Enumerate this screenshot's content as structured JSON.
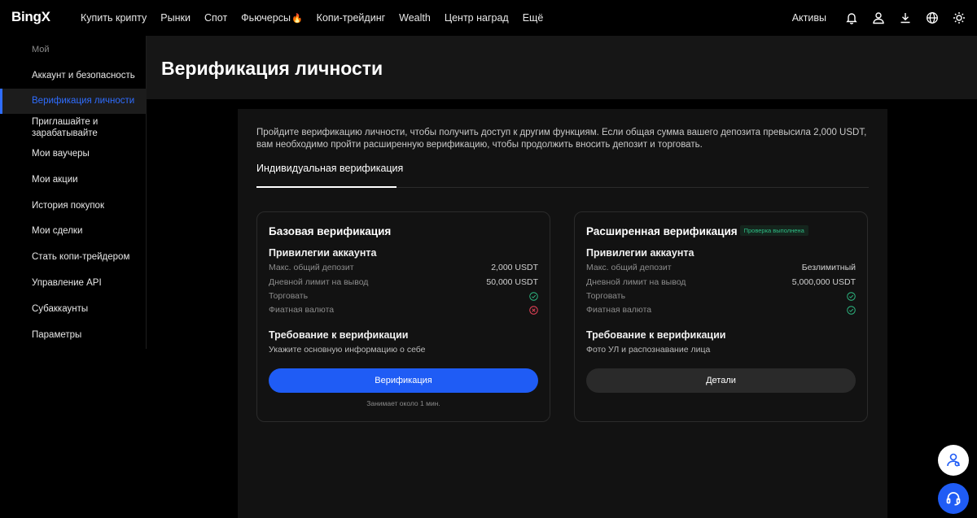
{
  "brand": {
    "logo": "BingX"
  },
  "nav": {
    "items": [
      "Купить крипту",
      "Рынки",
      "Спот",
      "Фьючерсы",
      "Копи-трейдинг",
      "Wealth",
      "Центр наград",
      "Ещё"
    ],
    "assets": "Активы"
  },
  "sidebar": {
    "header": "Мой",
    "items": [
      "Аккаунт и безопасность",
      "Верификация личности",
      "Приглашайте и",
      "зарабатывайте",
      "Мои ваучеры",
      "Мои акции",
      "История покупок",
      "Мои сделки",
      "Стать копи-трейдером",
      "Управление API",
      "Субаккаунты",
      "Параметры"
    ],
    "active_index": 1
  },
  "page": {
    "title": "Верификация личности",
    "intro": "Пройдите верификацию личности, чтобы получить доступ к другим функциям. Если общая сумма вашего депозита превысила 2,000 USDT, вам необходимо пройти расширенную верификацию, чтобы продолжить вносить депозит и торговать.",
    "tab": "Индивидуальная верификация"
  },
  "cards": {
    "basic": {
      "title": "Базовая верификация",
      "privileges_title": "Привилегии аккаунта",
      "rows": [
        {
          "label": "Макс. общий депозит",
          "value": "2,000 USDT"
        },
        {
          "label": "Дневной лимит на вывод",
          "value": "50,000 USDT"
        },
        {
          "label": "Торговать",
          "status": "ok"
        },
        {
          "label": "Фиатная валюта",
          "status": "no"
        }
      ],
      "req_title": "Требование к верификации",
      "req_text": "Укажите основную информацию о себе",
      "button": "Верификация",
      "note": "Занимает около 1 мин."
    },
    "advanced": {
      "title": "Расширенная верификация",
      "badge": "Проверка выполнена",
      "privileges_title": "Привилегии аккаунта",
      "rows": [
        {
          "label": "Макс. общий депозит",
          "value": "Безлимитный"
        },
        {
          "label": "Дневной лимит на вывод",
          "value": "5,000,000 USDT"
        },
        {
          "label": "Торговать",
          "status": "ok"
        },
        {
          "label": "Фиатная валюта",
          "status": "ok"
        }
      ],
      "req_title": "Требование к верификации",
      "req_text": "Фото УЛ и распознавание лица",
      "button": "Детали"
    }
  },
  "colors": {
    "accent": "#1f5cf5",
    "active_text": "#2f6dff",
    "success": "#2ebd85",
    "danger": "#f6465d"
  },
  "icons": [
    "bell-icon",
    "user-icon",
    "download-icon",
    "globe-icon",
    "sun-icon",
    "fire-icon",
    "user-group-icon",
    "headset-icon"
  ]
}
